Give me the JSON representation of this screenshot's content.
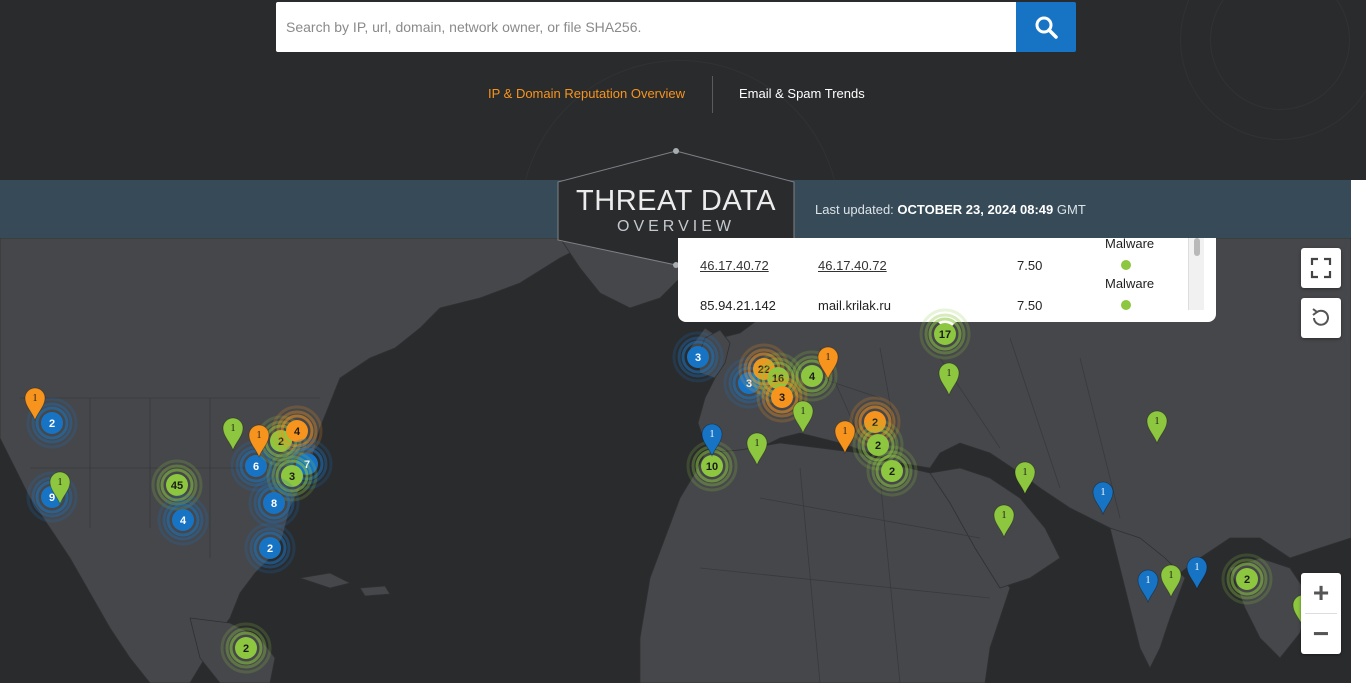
{
  "search": {
    "placeholder": "Search by IP, url, domain, network owner, or file SHA256.",
    "button_icon": "search-icon"
  },
  "tabs": [
    {
      "label": "IP & Domain Reputation Overview",
      "active": true
    },
    {
      "label": "Email & Spam Trends",
      "active": false
    }
  ],
  "banner": {
    "title": "THREAT DATA",
    "subtitle": "OVERVIEW",
    "last_updated_label": "Last updated:",
    "last_updated_value": "OCTOBER 23, 2024 08:49",
    "timezone": "GMT"
  },
  "popup": {
    "rows": [
      {
        "ip": "",
        "domain": "",
        "score": "",
        "type": "Malware"
      },
      {
        "ip": "46.17.40.72",
        "domain": "46.17.40.72",
        "score": "7.50",
        "type": "Malware"
      },
      {
        "ip": "85.94.21.142",
        "domain": "mail.krilak.ru",
        "score": "7.50",
        "type": ""
      }
    ]
  },
  "map_controls": {
    "fullscreen_icon": "fullscreen-icon",
    "reset_icon": "reset-rotate-icon",
    "zoom_in": "+",
    "zoom_out": "−"
  },
  "colors": {
    "green": "#8dc63f",
    "blue": "#1774c5",
    "orange": "#f7941d",
    "accent_tab": "#f7941d",
    "banner": "#364a58",
    "land": "#46474a",
    "water": "#2a2b2d"
  },
  "clusters": [
    {
      "label": "2",
      "color": "blue"
    },
    {
      "label": "9",
      "color": "blue"
    },
    {
      "label": "45",
      "color": "green"
    },
    {
      "label": "4",
      "color": "blue"
    },
    {
      "label": "6",
      "color": "blue"
    },
    {
      "label": "2",
      "color": "green"
    },
    {
      "label": "4",
      "color": "orange"
    },
    {
      "label": "7",
      "color": "blue"
    },
    {
      "label": "3",
      "color": "green"
    },
    {
      "label": "8",
      "color": "blue"
    },
    {
      "label": "2",
      "color": "blue"
    },
    {
      "label": "2",
      "color": "green"
    },
    {
      "label": "3",
      "color": "blue"
    },
    {
      "label": "3",
      "color": "blue"
    },
    {
      "label": "22",
      "color": "orange"
    },
    {
      "label": "16",
      "color": "green"
    },
    {
      "label": "4",
      "color": "green"
    },
    {
      "label": "3",
      "color": "orange"
    },
    {
      "label": "10",
      "color": "green"
    },
    {
      "label": "2",
      "color": "orange"
    },
    {
      "label": "2",
      "color": "green"
    },
    {
      "label": "2",
      "color": "green"
    },
    {
      "label": "17",
      "color": "green"
    },
    {
      "label": "2",
      "color": "green"
    }
  ],
  "pins": [
    {
      "label": "1",
      "color": "orange"
    },
    {
      "label": "1",
      "color": "green"
    },
    {
      "label": "1",
      "color": "orange"
    },
    {
      "label": "1",
      "color": "green"
    },
    {
      "label": "1",
      "color": "blue"
    },
    {
      "label": "1",
      "color": "green"
    },
    {
      "label": "1",
      "color": "orange"
    },
    {
      "label": "1",
      "color": "green"
    },
    {
      "label": "1",
      "color": "orange"
    },
    {
      "label": "1",
      "color": "green"
    },
    {
      "label": "1",
      "color": "green"
    },
    {
      "label": "1",
      "color": "green"
    },
    {
      "label": "1",
      "color": "green"
    },
    {
      "label": "1",
      "color": "blue"
    },
    {
      "label": "1",
      "color": "green"
    },
    {
      "label": "1",
      "color": "blue"
    },
    {
      "label": "1",
      "color": "green"
    },
    {
      "label": "1",
      "color": "blue"
    }
  ]
}
